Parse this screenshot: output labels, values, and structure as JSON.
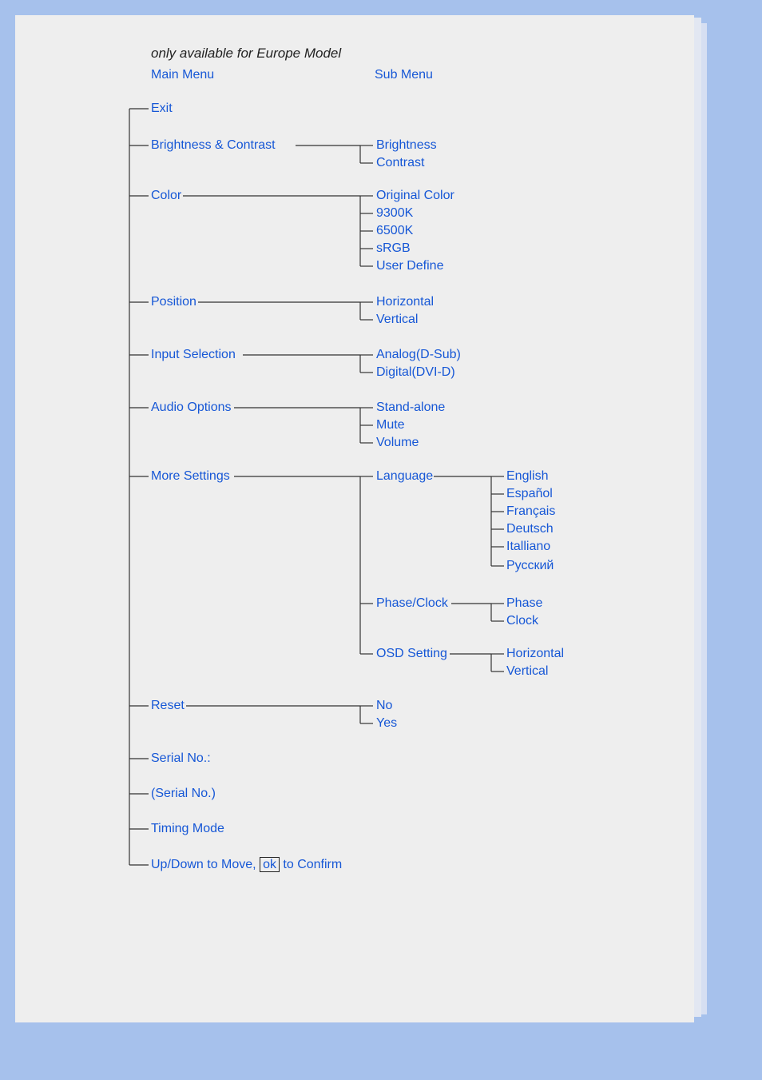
{
  "note": "only available for Europe Model",
  "headers": {
    "main": "Main Menu",
    "sub": "Sub Menu"
  },
  "main": {
    "exit": "Exit",
    "brightness_contrast": "Brightness & Contrast",
    "color": "Color",
    "position": "Position",
    "input_selection": "Input Selection",
    "audio_options": "Audio Options",
    "more_settings": "More Settings",
    "reset": "Reset",
    "serial_no_label": "Serial No.:",
    "serial_no_value": "(Serial No.)",
    "timing_mode": "Timing Mode",
    "hint_pre": "Up/Down to Move, ",
    "hint_ok": "ok",
    "hint_post": " to Confirm"
  },
  "sub": {
    "brightness": "Brightness",
    "contrast": "Contrast",
    "original_color": "Original Color",
    "k9300": "9300K",
    "k6500": "6500K",
    "srgb": "sRGB",
    "user_define": "User Define",
    "horizontal": "Horizontal",
    "vertical": "Vertical",
    "analog": "Analog(D-Sub)",
    "digital": "Digital(DVI-D)",
    "standalone": "Stand-alone",
    "mute": "Mute",
    "volume": "Volume",
    "language": "Language",
    "phase_clock": "Phase/Clock",
    "osd_setting": "OSD Setting",
    "no": "No",
    "yes": "Yes"
  },
  "sub2": {
    "english": "English",
    "espanol": "Español",
    "francais": "Français",
    "deutsch": "Deutsch",
    "italliano": "Italliano",
    "russian": "Русский",
    "phase": "Phase",
    "clock": "Clock",
    "osd_h": "Horizontal",
    "osd_v": "Vertical"
  }
}
